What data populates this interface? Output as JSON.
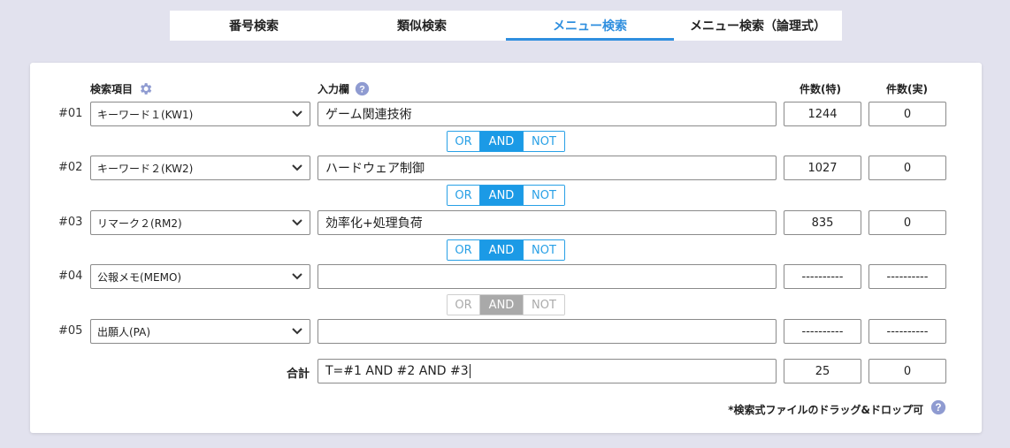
{
  "tabs": [
    {
      "label": "番号検索",
      "active": false
    },
    {
      "label": "類似検索",
      "active": false
    },
    {
      "label": "メニュー検索",
      "active": true
    },
    {
      "label": "メニュー検索（論理式）",
      "active": false
    }
  ],
  "headers": {
    "field": "検索項目",
    "input": "入力欄",
    "count_tok": "件数(特)",
    "count_jitsu": "件数(実)"
  },
  "rows": [
    {
      "num": "#01",
      "field": "キーワード１(KW1)",
      "value": "ゲーム関連技術",
      "count_tok": "1244",
      "count_jitsu": "0"
    },
    {
      "num": "#02",
      "field": "キーワード２(KW2)",
      "value": "ハードウェア制御",
      "count_tok": "1027",
      "count_jitsu": "0"
    },
    {
      "num": "#03",
      "field": "リマーク２(RM2)",
      "value": "効率化+処理負荷",
      "count_tok": "835",
      "count_jitsu": "0"
    },
    {
      "num": "#04",
      "field": "公報メモ(MEMO)",
      "value": "",
      "count_tok": "----------",
      "count_jitsu": "----------"
    },
    {
      "num": "#05",
      "field": "出願人(PA)",
      "value": "",
      "count_tok": "----------",
      "count_jitsu": "----------"
    }
  ],
  "operators": [
    {
      "or": "OR",
      "and": "AND",
      "not": "NOT",
      "selected": "AND",
      "enabled": true
    },
    {
      "or": "OR",
      "and": "AND",
      "not": "NOT",
      "selected": "AND",
      "enabled": true
    },
    {
      "or": "OR",
      "and": "AND",
      "not": "NOT",
      "selected": "AND",
      "enabled": true
    },
    {
      "or": "OR",
      "and": "AND",
      "not": "NOT",
      "selected": "AND",
      "enabled": false
    }
  ],
  "total": {
    "label": "合計",
    "formula": "T=#1 AND #2 AND #3",
    "count_tok": "25",
    "count_jitsu": "0"
  },
  "footer": {
    "note": "*検索式ファイルのドラッグ&ドロップ可"
  },
  "colors": {
    "accent": "#2f8fdf",
    "operator_active": "#1b9ae6",
    "operator_disabled": "#a9a9a9",
    "icon": "#8f9bd1",
    "background": "#e2e2ee"
  },
  "icons": {
    "settings": "gear-icon",
    "help": "question-circle-icon",
    "dropdown": "chevron-down-icon"
  }
}
